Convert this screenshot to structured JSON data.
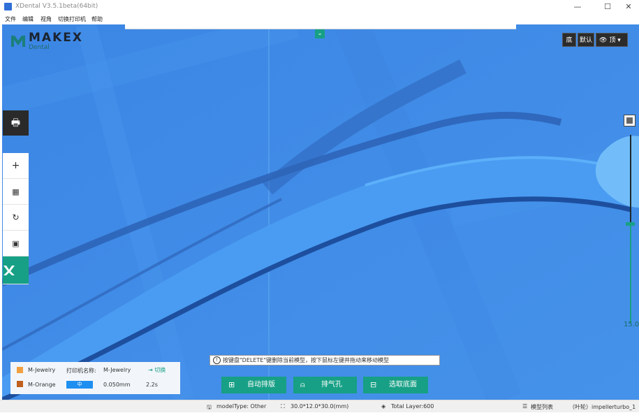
{
  "window": {
    "title": "XDental V3.5.1beta(64bit)",
    "minimize": "—",
    "maximize": "☐",
    "close": "✕"
  },
  "menu": {
    "items": [
      "文件",
      "编辑",
      "视角",
      "切换打印机",
      "帮助"
    ]
  },
  "logo": {
    "brand": "MAKEX",
    "sub": "Dental"
  },
  "view_buttons": {
    "bottom": "底",
    "default": "默认",
    "eye_label": "顶",
    "dropdown": "▾"
  },
  "toolbar": {
    "collapse": "⌄"
  },
  "slider": {
    "value": "15.0"
  },
  "hint": {
    "text": "按键盘\"DELETE\"键删除当前模型，按下鼠标左键并拖动来移动模型"
  },
  "actions": [
    {
      "label": "自动排版",
      "icon": "grid-icon"
    },
    {
      "label": "排气孔",
      "icon": "tooth-icon"
    },
    {
      "label": "选取底面",
      "icon": "base-icon"
    }
  ],
  "material": {
    "row1": {
      "name": "M-Jewelry",
      "printer_label": "打印机名称:",
      "printer_value": "M-Jewelry",
      "switch_label": "切换"
    },
    "row2": {
      "name": "M-Orange",
      "quality": "中",
      "layer": "0.050mm",
      "time": "2.2s"
    },
    "colors": {
      "jewelry": "#f0a040",
      "orange": "#c06020"
    }
  },
  "status": {
    "model_type": "modelType: Other",
    "dimensions": "30.0*12.0*30.0(mm)",
    "layers": "Total Layer:600",
    "list": "模型列表",
    "file": "（叶轮）impellerturbo_1"
  },
  "colors": {
    "accent": "#17a085",
    "viewport": "#3f8ae6",
    "model": "#4da6f5"
  }
}
